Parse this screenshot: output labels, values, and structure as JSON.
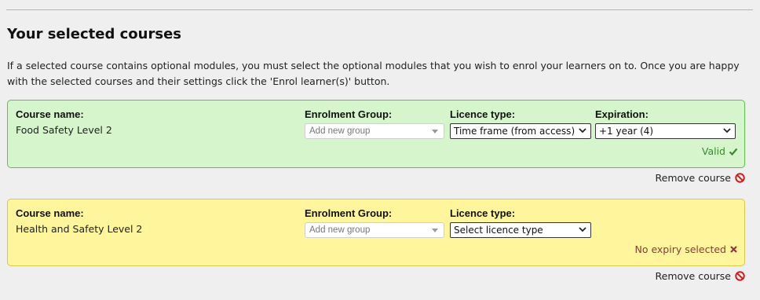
{
  "header": {
    "title": "Your selected courses",
    "intro": "If a selected course contains optional modules, you must select the optional modules that you wish to enrol your learners on to. Once you are happy with the selected courses and their settings click the 'Enrol learner(s)' button."
  },
  "labels": {
    "course_name": "Course name:",
    "enrolment_group": "Enrolment Group:",
    "licence_type": "Licence type:",
    "expiration": "Expiration:"
  },
  "courses": [
    {
      "name": "Food Safety Level 2",
      "group_placeholder": "Add new group",
      "licence_type": "Time frame (from access)",
      "expiration": "+1 year (4)",
      "status": "Valid",
      "status_icon": "check-icon",
      "remove_label": "Remove course"
    },
    {
      "name": "Health and Safety Level 2",
      "group_placeholder": "Add new group",
      "licence_type": "Select licence type",
      "status": "No expiry selected",
      "status_icon": "cross-icon",
      "remove_label": "Remove course"
    }
  ],
  "colors": {
    "valid_bg": "#d7f5cd",
    "valid_border": "#5ec14a",
    "invalid_bg": "#fff59c",
    "invalid_border": "#d7c74a",
    "remove_icon": "#cc1e1e"
  }
}
